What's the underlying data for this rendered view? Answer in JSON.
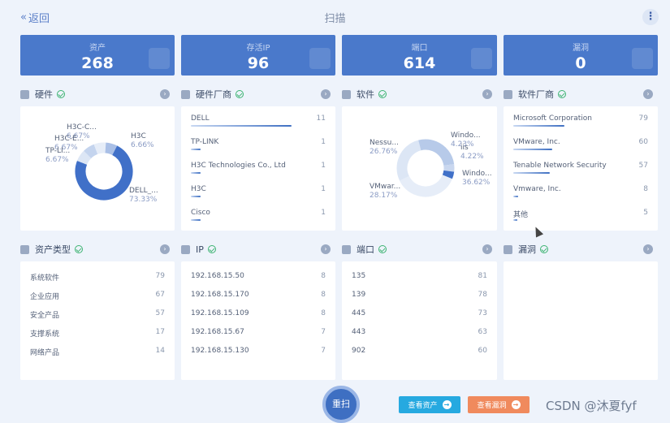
{
  "topbar": {
    "back": "返回",
    "title": "扫描",
    "menu": "⋮"
  },
  "stats": [
    {
      "label": "资产",
      "value": "268"
    },
    {
      "label": "存活IP",
      "value": "96"
    },
    {
      "label": "端口",
      "value": "614"
    },
    {
      "label": "漏洞",
      "value": "0"
    }
  ],
  "sections": {
    "hardware": "硬件",
    "hardware_vendor": "硬件厂商",
    "software": "软件",
    "software_vendor": "软件厂商",
    "asset_type": "资产类型",
    "ip": "IP",
    "port": "端口",
    "vuln": "漏洞"
  },
  "hardware_pie": {
    "labels": [
      {
        "name": "H3C-C...",
        "pct": "6.67%"
      },
      {
        "name": "H3C-E...",
        "pct": "6.67%"
      },
      {
        "name": "TP-LI...",
        "pct": "6.67%"
      },
      {
        "name": "H3C",
        "pct": "6.66%"
      },
      {
        "name": "DELL_...",
        "pct": "73.33%"
      }
    ]
  },
  "software_pie": {
    "labels": [
      {
        "name": "Nessu...",
        "pct": "26.76%"
      },
      {
        "name": "Windo...",
        "pct": "4.23%"
      },
      {
        "name": "iis",
        "pct": "4.22%"
      },
      {
        "name": "Windo...",
        "pct": "36.62%"
      },
      {
        "name": "VMwar...",
        "pct": "28.17%"
      }
    ]
  },
  "hardware_vendors": [
    {
      "name": "DELL",
      "count": "11",
      "frac": 0.73
    },
    {
      "name": "TP-LINK",
      "count": "1",
      "frac": 0.07
    },
    {
      "name": "H3C Technologies Co., Ltd",
      "count": "1",
      "frac": 0.07
    },
    {
      "name": "H3C",
      "count": "1",
      "frac": 0.07
    },
    {
      "name": "Cisco",
      "count": "1",
      "frac": 0.07
    }
  ],
  "software_vendors": [
    {
      "name": "Microsoft Corporation",
      "count": "79",
      "frac": 0.42
    },
    {
      "name": "VMware, Inc.",
      "count": "60",
      "frac": 0.32
    },
    {
      "name": "Tenable Network Security",
      "count": "57",
      "frac": 0.3
    },
    {
      "name": "Vmware, Inc.",
      "count": "8",
      "frac": 0.04
    },
    {
      "name": "其他",
      "count": "5",
      "frac": 0.03
    }
  ],
  "asset_types": [
    {
      "name": "系统软件",
      "count": "79"
    },
    {
      "name": "企业应用",
      "count": "67"
    },
    {
      "name": "安全产品",
      "count": "57"
    },
    {
      "name": "支撑系统",
      "count": "17"
    },
    {
      "name": "网络产品",
      "count": "14"
    }
  ],
  "ips": [
    {
      "name": "192.168.15.50",
      "count": "8"
    },
    {
      "name": "192.168.15.170",
      "count": "8"
    },
    {
      "name": "192.168.15.109",
      "count": "8"
    },
    {
      "name": "192.168.15.67",
      "count": "7"
    },
    {
      "name": "192.168.15.130",
      "count": "7"
    }
  ],
  "ports": [
    {
      "name": "135",
      "count": "81"
    },
    {
      "name": "139",
      "count": "78"
    },
    {
      "name": "445",
      "count": "73"
    },
    {
      "name": "443",
      "count": "63"
    },
    {
      "name": "902",
      "count": "60"
    }
  ],
  "actions": {
    "scan": "重扫",
    "view_assets": "查看资产",
    "view_vulns": "查看漏洞"
  },
  "watermark": "CSDN @沐夏fyf",
  "colors": {
    "primary": "#4a79cb",
    "success": "#3cb371",
    "info": "#26a9e0",
    "warn": "#f08a5d"
  }
}
